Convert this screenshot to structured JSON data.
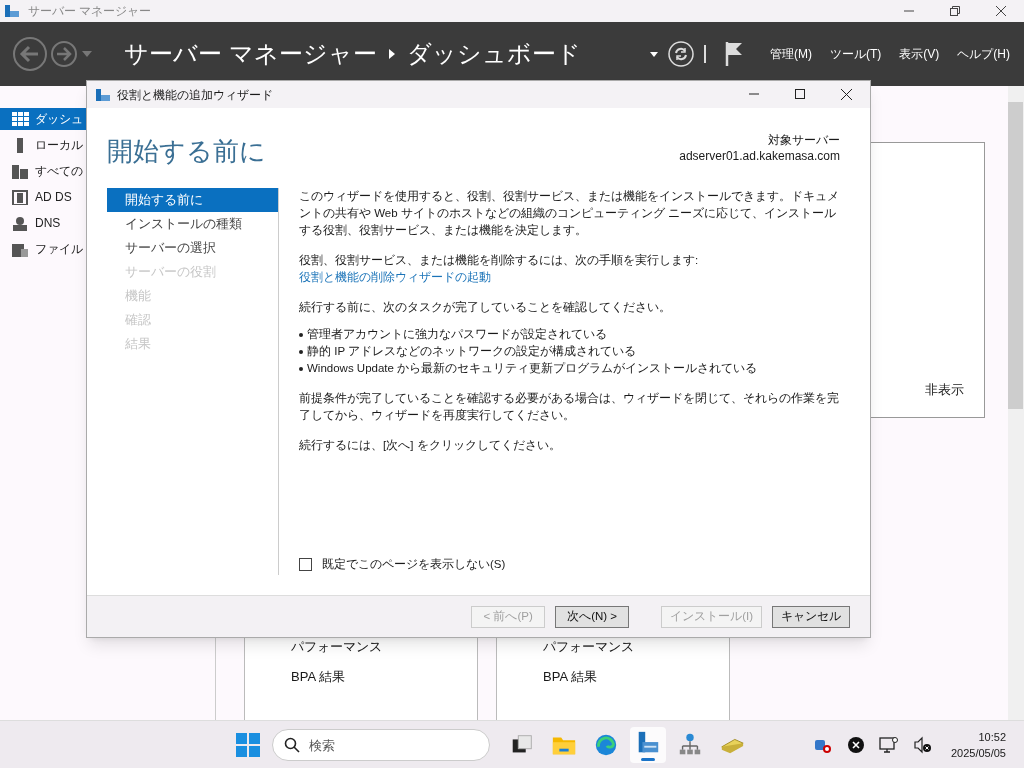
{
  "window": {
    "title": "サーバー マネージャー"
  },
  "header": {
    "breadcrumb": [
      "サーバー マネージャー",
      "ダッシュボード"
    ],
    "menu": [
      "管理(M)",
      "ツール(T)",
      "表示(V)",
      "ヘルプ(H)"
    ]
  },
  "sidebar": {
    "items": [
      {
        "label": "ダッシュ",
        "selected": true
      },
      {
        "label": "ローカル",
        "selected": false
      },
      {
        "label": "すべての",
        "selected": false
      },
      {
        "label": "AD DS",
        "selected": false
      },
      {
        "label": "DNS",
        "selected": false
      },
      {
        "label": "ファイル",
        "selected": false
      }
    ]
  },
  "dashboard": {
    "hide_label": "非表示",
    "tiles": [
      {
        "lines": [
          "パフォーマンス",
          "BPA 結果"
        ]
      },
      {
        "lines": [
          "パフォーマンス",
          "BPA 結果"
        ]
      }
    ]
  },
  "wizard": {
    "title": "役割と機能の追加ウィザード",
    "heading": "開始する前に",
    "target_label": "対象サーバー",
    "target_server": "adserver01.ad.kakemasa.com",
    "steps": [
      {
        "label": "開始する前に",
        "selected": true,
        "disabled": false
      },
      {
        "label": "インストールの種類",
        "selected": false,
        "disabled": false
      },
      {
        "label": "サーバーの選択",
        "selected": false,
        "disabled": false
      },
      {
        "label": "サーバーの役割",
        "selected": false,
        "disabled": true
      },
      {
        "label": "機能",
        "selected": false,
        "disabled": true
      },
      {
        "label": "確認",
        "selected": false,
        "disabled": true
      },
      {
        "label": "結果",
        "selected": false,
        "disabled": true
      }
    ],
    "content": [
      {
        "kind": "paragraph",
        "text": "このウィザードを使用すると、役割、役割サービス、または機能をインストールできます。ドキュメントの共有や Web サイトのホストなどの組織のコンピューティング ニーズに応じて、インストールする役割、役割サービス、または機能を決定します。"
      },
      {
        "kind": "paragraph",
        "text": "役割、役割サービス、または機能を削除するには、次の手順を実行します:",
        "link": "役割と機能の削除ウィザードの起動"
      },
      {
        "kind": "paragraph",
        "text": "続行する前に、次のタスクが完了していることを確認してください。"
      },
      {
        "kind": "bullets",
        "items": [
          "管理者アカウントに強力なパスワードが設定されている",
          "静的 IP アドレスなどのネットワークの設定が構成されている",
          "Windows Update から最新のセキュリティ更新プログラムがインストールされている"
        ]
      },
      {
        "kind": "paragraph",
        "text": "前提条件が完了していることを確認する必要がある場合は、ウィザードを閉じて、それらの作業を完了してから、ウィザードを再度実行してください。"
      },
      {
        "kind": "paragraph",
        "text": "続行するには、[次へ] をクリックしてください。"
      }
    ],
    "checkbox": {
      "label": "既定でこのページを表示しない(S)",
      "checked": false
    },
    "buttons": [
      {
        "label": "< 前へ(P)",
        "disabled": true
      },
      {
        "label": "次へ(N) >",
        "disabled": false
      },
      {
        "label": "インストール(I)",
        "disabled": true
      },
      {
        "label": "キャンセル",
        "disabled": false
      }
    ]
  },
  "taskbar": {
    "search_placeholder": "検索",
    "apps": [
      {
        "kind": "taskview",
        "active": false
      },
      {
        "kind": "folder",
        "active": false
      },
      {
        "kind": "browser",
        "active": false
      },
      {
        "kind": "server",
        "active": true
      },
      {
        "kind": "network",
        "active": false
      },
      {
        "kind": "money",
        "active": false
      }
    ],
    "time": "10:52",
    "date": "2025/05/05"
  }
}
